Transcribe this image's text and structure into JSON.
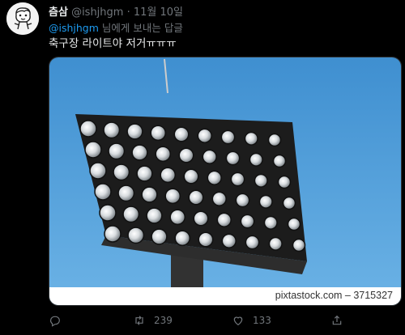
{
  "tweet": {
    "author_name": "츰삼",
    "handle": "@ishjhgm",
    "separator": "·",
    "date": "11월 10일",
    "reply_to": "@ishjhgm",
    "reply_suffix": " 님에게 보내는 답글",
    "text": "축구장 라이트야 저거ㅠㅠㅠ",
    "image_watermark": "pixtastock.com – 3715327"
  },
  "actions": {
    "reply_count": "",
    "retweet_count": "239",
    "like_count": "133",
    "share_label": ""
  },
  "icons": [
    "avatar-character",
    "reply-icon",
    "retweet-icon",
    "like-icon",
    "share-icon"
  ],
  "colors": {
    "background": "#000000",
    "accent": "#1d9bf0",
    "muted": "#71767b",
    "sky": "#5aa3d8"
  }
}
